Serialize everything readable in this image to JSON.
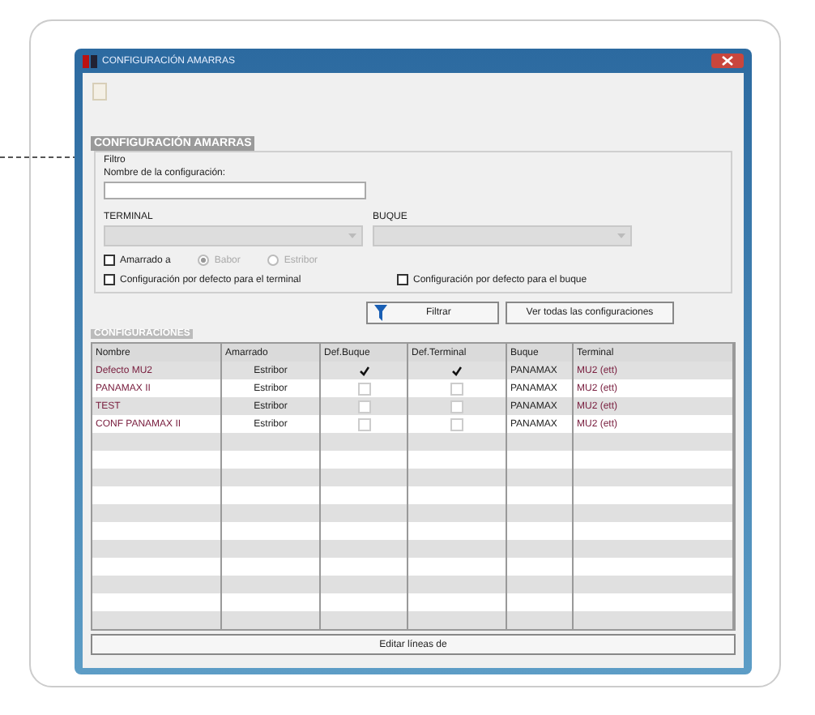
{
  "window": {
    "title": "CONFIGURACIÓN AMARRAS"
  },
  "heading": "CONFIGURACIÓN AMARRAS",
  "filter": {
    "legend": "Filtro",
    "name_label": "Nombre de la configuración:",
    "terminal_label": "TERMINAL",
    "buque_label": "BUQUE",
    "moored": {
      "label": "Amarrado a",
      "checked": false,
      "options": [
        {
          "label": "Babor",
          "selected": true
        },
        {
          "label": "Estribor",
          "selected": false
        }
      ]
    },
    "defaults": [
      {
        "label": "Configuración por defecto para el terminal",
        "checked": false
      },
      {
        "label": "Configuración por defecto para el buque",
        "checked": false
      }
    ],
    "buttons": [
      "Filtrar",
      "Ver todas las configuraciones"
    ]
  },
  "table": {
    "title": "CONFIGURACIONES",
    "columns": [
      "Nombre",
      "Amarrado",
      "Def.Buque",
      "Def.Terminal",
      "Buque",
      "Terminal"
    ],
    "rows": [
      {
        "name": "Defecto MU2",
        "moored": "Estribor",
        "def_buque": true,
        "def_terminal": true,
        "buque": "PANAMAX",
        "terminal": "MU2 (ett)"
      },
      {
        "name": "PANAMAX II",
        "moored": "Estribor",
        "def_buque": false,
        "def_terminal": false,
        "buque": "PANAMAX",
        "terminal": "MU2 (ett)"
      },
      {
        "name": "TEST",
        "moored": "Estribor",
        "def_buque": false,
        "def_terminal": false,
        "buque": "PANAMAX",
        "terminal": "MU2 (ett)"
      },
      {
        "name": "CONF PANAMAX II",
        "moored": "Estribor",
        "def_buque": false,
        "def_terminal": false,
        "buque": "PANAMAX",
        "terminal": "MU2 (ett)"
      }
    ]
  },
  "bottom_button": "Editar líneas de"
}
